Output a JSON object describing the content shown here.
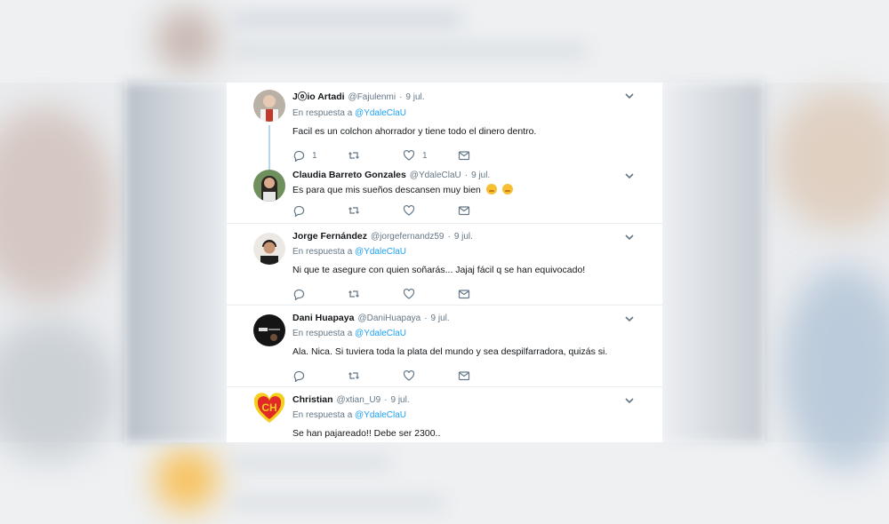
{
  "colors": {
    "link": "#1da1f2",
    "text": "#14171a",
    "muted": "#657786",
    "thread_line": "#b9d5ea",
    "separator": "#e6ecf0"
  },
  "tweets": [
    {
      "name": "Jⓞio Artadi",
      "handle": "@Fajulenmi",
      "dot": "·",
      "date": "9 jul.",
      "reply_prefix": "En respuesta a",
      "reply_mention": "@YdaleClaU",
      "text": "Facil es un colchon ahorrador y tiene todo el dinero dentro.",
      "reply_count": "1",
      "retweet_count": "",
      "like_count": "1",
      "avatar_icon": "person-photo-avatar"
    },
    {
      "name": "Claudia Barreto Gonzales",
      "handle": "@YdaleClaU",
      "dot": "·",
      "date": "9 jul.",
      "text": "Es para que mis sueños descansen muy bien",
      "reply_count": "",
      "retweet_count": "",
      "like_count": "",
      "avatar_icon": "person-photo-avatar"
    },
    {
      "name": "Jorge Fernández",
      "handle": "@jorgefernandz59",
      "dot": "·",
      "date": "9 jul.",
      "reply_prefix": "En respuesta a",
      "reply_mention": "@YdaleClaU",
      "text": "Ni que te asegure con quien soñarás... Jajaj fácil q se han equivocado!",
      "reply_count": "",
      "retweet_count": "",
      "like_count": "",
      "avatar_icon": "person-photo-avatar"
    },
    {
      "name": "Dani Huapaya",
      "handle": "@DaniHuapaya",
      "dot": "·",
      "date": "9 jul.",
      "reply_prefix": "En respuesta a",
      "reply_mention": "@YdaleClaU",
      "text": "Ala. Nica. Si tuviera toda la plata del mundo y sea despilfarradora, quizás si.",
      "reply_count": "",
      "retweet_count": "",
      "like_count": "",
      "avatar_icon": "person-photo-avatar"
    },
    {
      "name": "Christian",
      "handle": "@xtian_U9",
      "dot": "·",
      "date": "9 jul.",
      "reply_prefix": "En respuesta a",
      "reply_mention": "@YdaleClaU",
      "text": "Se han pajareado!! Debe ser 2300..",
      "avatar_text": "CH",
      "avatar_icon": "heart-logo-avatar"
    }
  ]
}
